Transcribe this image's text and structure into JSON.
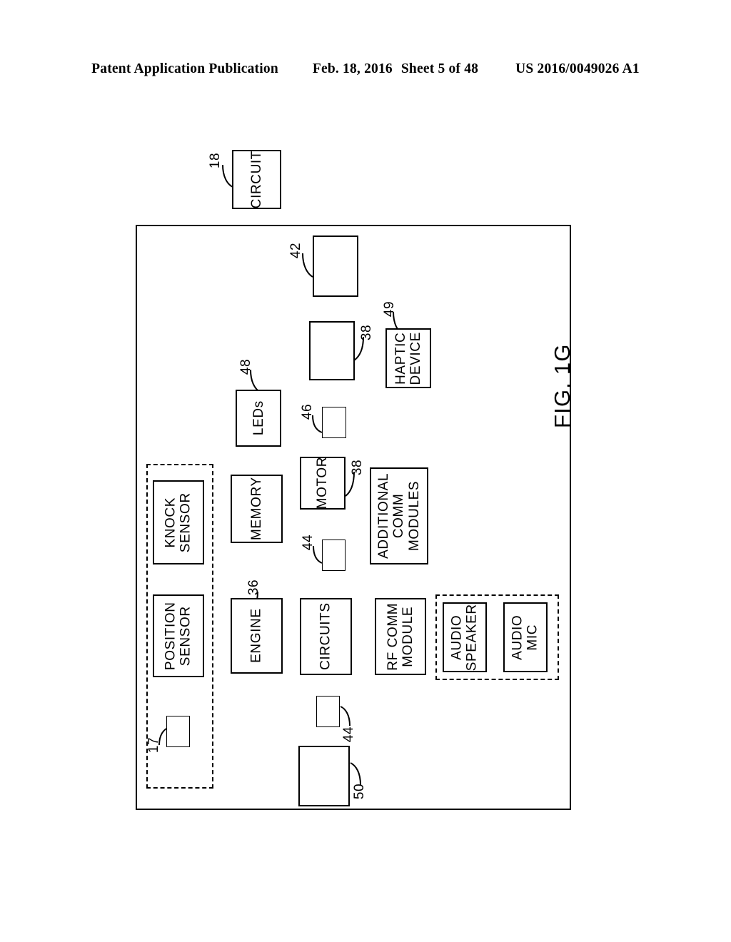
{
  "header": {
    "publication": "Patent Application Publication",
    "date": "Feb. 18, 2016",
    "sheet": "Sheet 5 of 48",
    "patent_number": "US 2016/0049026 A1"
  },
  "figure": {
    "caption": "FIG. 1G",
    "orientation": "rotated-90-ccw",
    "outer_box": {
      "label": "",
      "reference": ""
    },
    "blocks": [
      {
        "id": "circuit",
        "label": "CIRCUIT",
        "reference": "18",
        "outside": true
      },
      {
        "id": "block-42",
        "label": "",
        "reference": "42"
      },
      {
        "id": "block-38-upper",
        "label": "",
        "reference": "38"
      },
      {
        "id": "haptic-device",
        "label": "HAPTIC\nDEVICE",
        "reference": "49"
      },
      {
        "id": "leds",
        "label": "LEDs",
        "reference": "48"
      },
      {
        "id": "block-46",
        "label": "",
        "reference": "46"
      },
      {
        "id": "motor",
        "label": "MOTOR",
        "reference": "38"
      },
      {
        "id": "memory",
        "label": "MEMORY",
        "reference": ""
      },
      {
        "id": "block-44-upper",
        "label": "",
        "reference": "44"
      },
      {
        "id": "additional-comm",
        "label": "ADDITIONAL\nCOMM\nMODULES",
        "reference": ""
      },
      {
        "id": "knock-sensor",
        "label": "KNOCK\nSENSOR",
        "reference": ""
      },
      {
        "id": "position-sensor",
        "label": "POSITION\nSENSOR",
        "reference": ""
      },
      {
        "id": "block-17",
        "label": "",
        "reference": "17"
      },
      {
        "id": "engine",
        "label": "ENGINE",
        "reference": "36"
      },
      {
        "id": "circuits",
        "label": "CIRCUITS",
        "reference": ""
      },
      {
        "id": "rf-comm-module",
        "label": "RF COMM\nMODULE",
        "reference": ""
      },
      {
        "id": "audio-speaker",
        "label": "AUDIO\nSPEAKER",
        "reference": ""
      },
      {
        "id": "audio-mic",
        "label": "AUDIO\nMIC",
        "reference": ""
      },
      {
        "id": "block-44-lower",
        "label": "",
        "reference": "44"
      },
      {
        "id": "block-50",
        "label": "",
        "reference": "50"
      }
    ],
    "groups": [
      {
        "id": "sensor-group",
        "style": "dashed"
      },
      {
        "id": "audio-group",
        "style": "dashed"
      }
    ],
    "references": [
      "18",
      "42",
      "38",
      "49",
      "48",
      "46",
      "38",
      "44",
      "36",
      "17",
      "44",
      "50"
    ]
  },
  "labels": {
    "circuit": "CIRCUIT",
    "haptic_line1": "HAPTIC",
    "haptic_line2": "DEVICE",
    "leds": "LEDs",
    "motor": "MOTOR",
    "memory": "MEMORY",
    "addl_line1": "ADDITIONAL",
    "addl_line2": "COMM",
    "addl_line3": "MODULES",
    "knock_line1": "KNOCK",
    "knock_line2": "SENSOR",
    "position_line1": "POSITION",
    "position_line2": "SENSOR",
    "engine": "ENGINE",
    "circuits": "CIRCUITS",
    "rf_line1": "RF COMM",
    "rf_line2": "MODULE",
    "spk_line1": "AUDIO",
    "spk_line2": "SPEAKER",
    "mic_line1": "AUDIO",
    "mic_line2": "MIC"
  },
  "refnums": {
    "r18": "18",
    "r42": "42",
    "r38a": "38",
    "r49": "49",
    "r48": "48",
    "r46": "46",
    "r38b": "38",
    "r44a": "44",
    "r36": "36",
    "r17": "17",
    "r44b": "44",
    "r50": "50"
  },
  "colors": {
    "ink": "#000000",
    "paper": "#ffffff"
  }
}
